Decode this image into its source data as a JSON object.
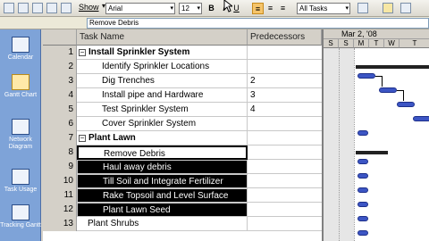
{
  "toolbar": {
    "show_label": "Show",
    "font": "Arial",
    "size": "12",
    "bold": "B",
    "italic": "I",
    "underline": "U",
    "filter": "All Tasks"
  },
  "entry_bar": {
    "value": "Remove Debris"
  },
  "view_bar": {
    "items": [
      {
        "label": "Calendar"
      },
      {
        "label": "Gantt Chart"
      },
      {
        "label": "Network Diagram"
      },
      {
        "label": "Task Usage"
      },
      {
        "label": "Tracking Gantt"
      }
    ]
  },
  "sheet": {
    "headers": {
      "name": "Task Name",
      "pred": "Predecessors"
    },
    "rows": [
      {
        "id": "1",
        "name": "Install Sprinkler System",
        "pred": ""
      },
      {
        "id": "2",
        "name": "Identify Sprinkler Locations",
        "pred": ""
      },
      {
        "id": "3",
        "name": "Dig Trenches",
        "pred": "2"
      },
      {
        "id": "4",
        "name": "Install pipe and Hardware",
        "pred": "3"
      },
      {
        "id": "5",
        "name": "Test Sprinkler System",
        "pred": "4"
      },
      {
        "id": "6",
        "name": "Cover Sprinkler System",
        "pred": ""
      },
      {
        "id": "7",
        "name": "Plant Lawn",
        "pred": ""
      },
      {
        "id": "8",
        "name": "Remove Debris",
        "pred": ""
      },
      {
        "id": "9",
        "name": "Haul away debris",
        "pred": ""
      },
      {
        "id": "10",
        "name": "Till Soil and Integrate Fertilizer",
        "pred": ""
      },
      {
        "id": "11",
        "name": "Rake Topsoil and Level Surface",
        "pred": ""
      },
      {
        "id": "12",
        "name": "Plant Lawn Seed",
        "pred": ""
      },
      {
        "id": "13",
        "name": "Plant Shrubs",
        "pred": ""
      }
    ]
  },
  "gantt": {
    "week_label": "Mar 2, '08",
    "days": [
      "S",
      "S",
      "M",
      "T",
      "W",
      "T"
    ]
  }
}
